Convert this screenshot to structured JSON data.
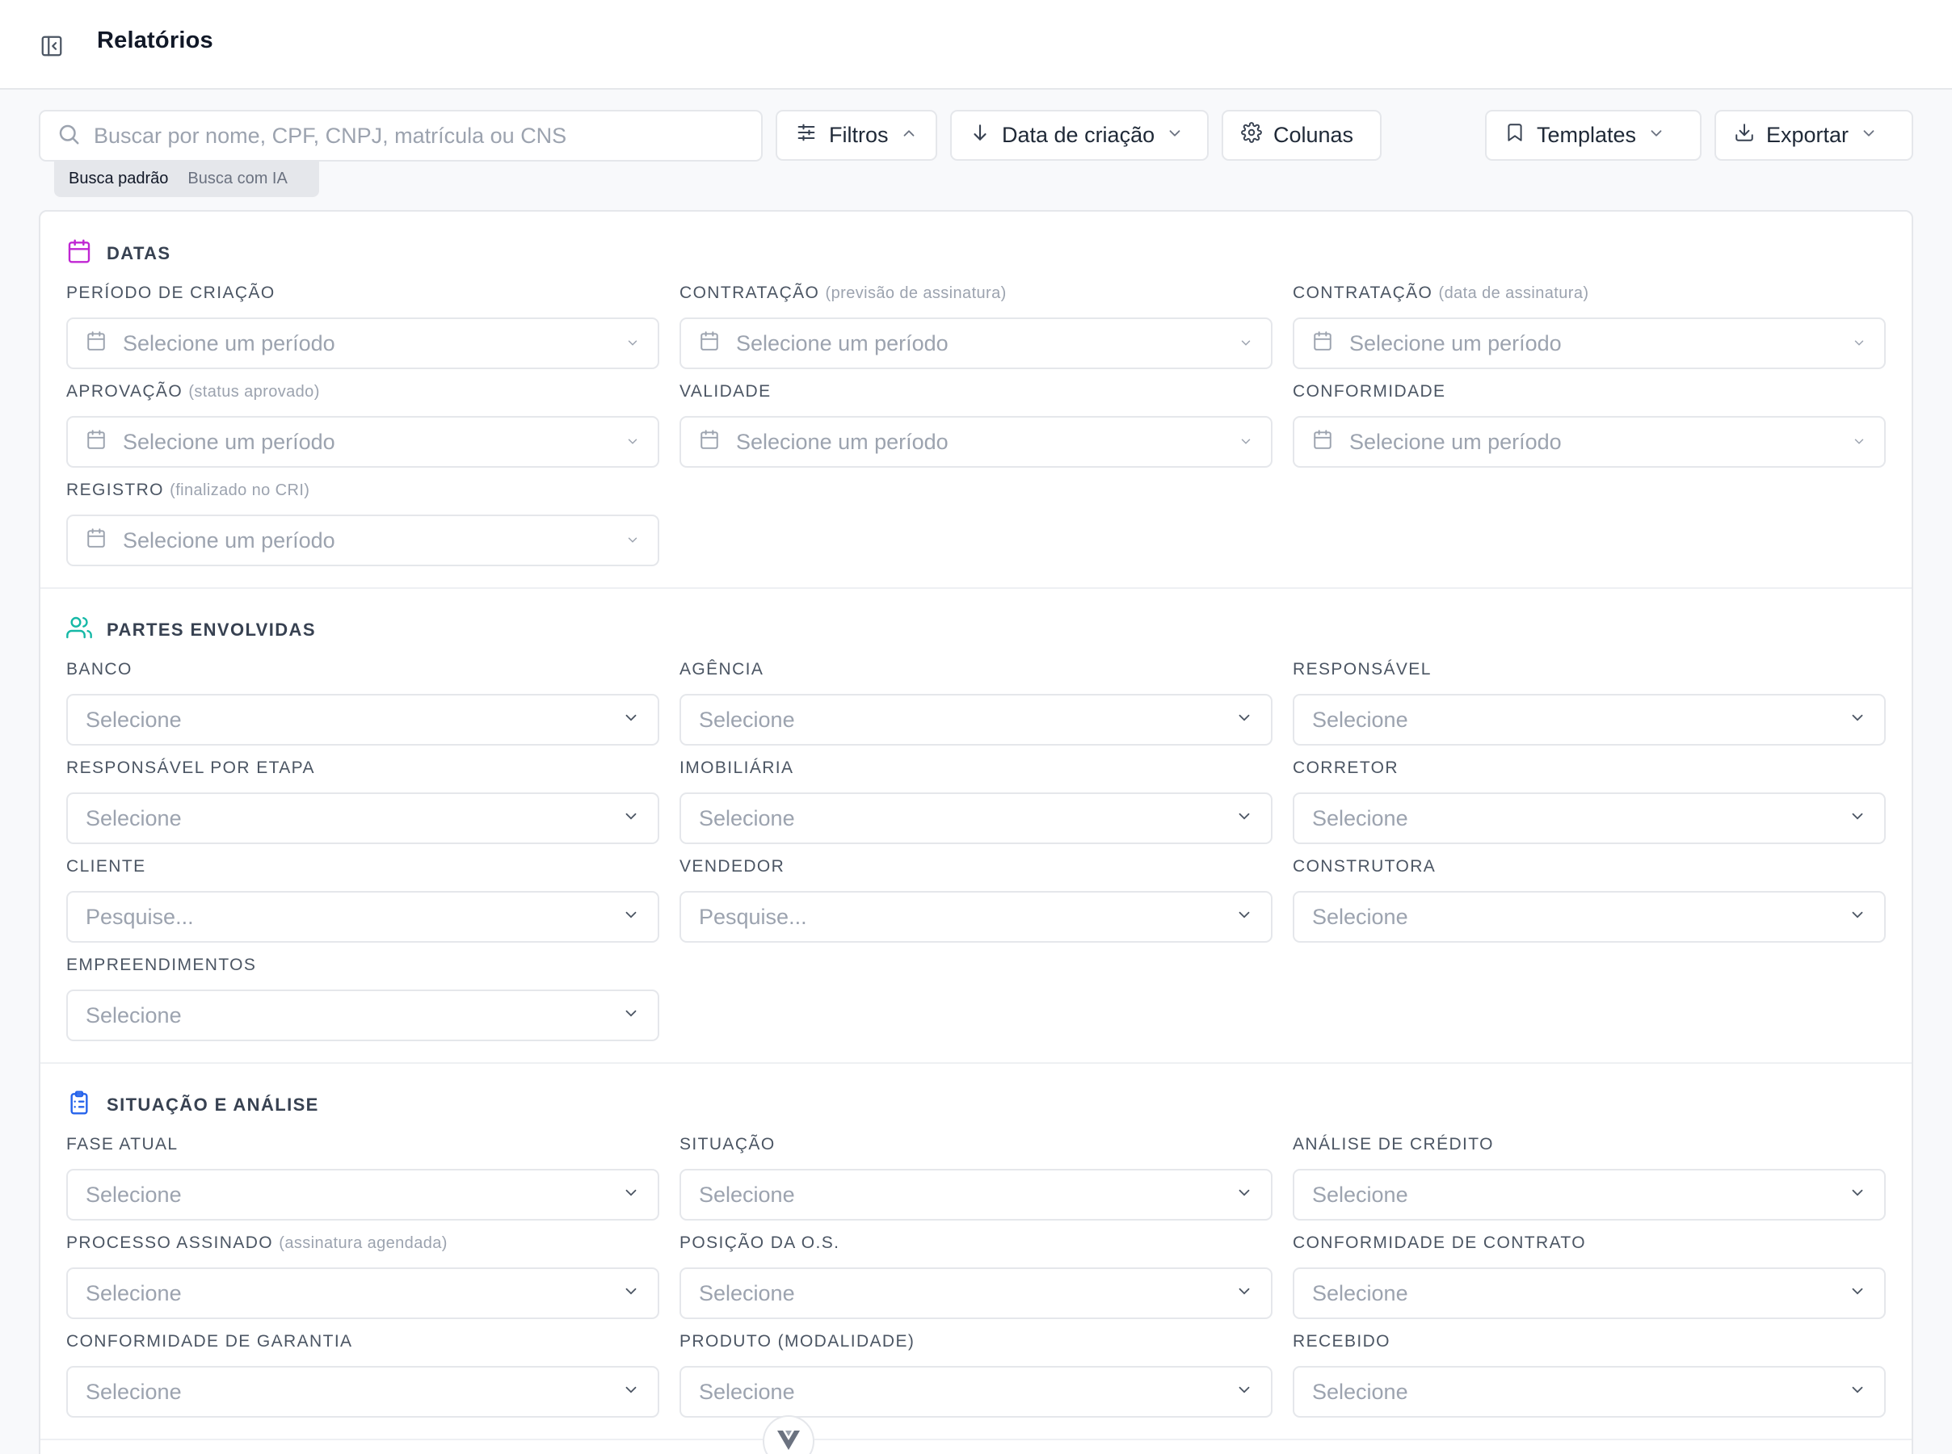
{
  "header": {
    "title": "Relatórios"
  },
  "search": {
    "placeholder": "Buscar por nome, CPF, CNPJ, matrícula ou CNS",
    "value": "",
    "modes": [
      "Busca padrão",
      "Busca com IA"
    ],
    "active_mode": "Busca padrão"
  },
  "toolbar": {
    "filters_label": "Filtros",
    "sort_label": "Data de criação",
    "columns_label": "Colunas",
    "templates_label": "Templates",
    "export_label": "Exportar"
  },
  "colors": {
    "dates_icon": "#c026d3",
    "parties_icon": "#14b8a6",
    "status_icon": "#2563eb",
    "border": "#e5e7eb",
    "placeholder": "#9ca3af"
  },
  "sections": {
    "dates": {
      "title": "DATAS",
      "icon": "calendar-icon",
      "fields": [
        {
          "label": "PERÍODO DE CRIAÇÃO",
          "hint": "",
          "placeholder": "Selecione um período"
        },
        {
          "label": "CONTRATAÇÃO",
          "hint": "(previsão de assinatura)",
          "placeholder": "Selecione um período"
        },
        {
          "label": "CONTRATAÇÃO",
          "hint": "(data de assinatura)",
          "placeholder": "Selecione um período"
        },
        {
          "label": "APROVAÇÃO",
          "hint": "(status aprovado)",
          "placeholder": "Selecione um período"
        },
        {
          "label": "VALIDADE",
          "hint": "",
          "placeholder": "Selecione um período"
        },
        {
          "label": "CONFORMIDADE",
          "hint": "",
          "placeholder": "Selecione um período"
        },
        {
          "label": "REGISTRO",
          "hint": "(finalizado no CRI)",
          "placeholder": "Selecione um período"
        }
      ]
    },
    "parties": {
      "title": "PARTES ENVOLVIDAS",
      "icon": "users-icon",
      "fields": [
        {
          "label": "BANCO",
          "placeholder": "Selecione"
        },
        {
          "label": "AGÊNCIA",
          "placeholder": "Selecione"
        },
        {
          "label": "RESPONSÁVEL",
          "placeholder": "Selecione"
        },
        {
          "label": "RESPONSÁVEL POR ETAPA",
          "placeholder": "Selecione"
        },
        {
          "label": "IMOBILIÁRIA",
          "placeholder": "Selecione"
        },
        {
          "label": "CORRETOR",
          "placeholder": "Selecione"
        },
        {
          "label": "CLIENTE",
          "placeholder": "Pesquise..."
        },
        {
          "label": "VENDEDOR",
          "placeholder": "Pesquise..."
        },
        {
          "label": "CONSTRUTORA",
          "placeholder": "Selecione"
        },
        {
          "label": "EMPREENDIMENTOS",
          "placeholder": "Selecione"
        }
      ]
    },
    "status": {
      "title": "SITUAÇÃO E ANÁLISE",
      "icon": "clipboard-list-icon",
      "fields": [
        {
          "label": "FASE ATUAL",
          "hint": "",
          "placeholder": "Selecione"
        },
        {
          "label": "SITUAÇÃO",
          "hint": "",
          "placeholder": "Selecione"
        },
        {
          "label": "ANÁLISE DE CRÉDITO",
          "hint": "",
          "placeholder": "Selecione"
        },
        {
          "label": "PROCESSO ASSINADO",
          "hint": "(assinatura agendada)",
          "placeholder": "Selecione"
        },
        {
          "label": "POSIÇÃO DA O.S.",
          "hint": "",
          "placeholder": "Selecione"
        },
        {
          "label": "CONFORMIDADE DE CONTRATO",
          "hint": "",
          "placeholder": "Selecione"
        },
        {
          "label": "CONFORMIDADE DE GARANTIA",
          "hint": "",
          "placeholder": "Selecione"
        },
        {
          "label": "PRODUTO (MODALIDADE)",
          "hint": "",
          "placeholder": "Selecione"
        },
        {
          "label": "RECEBIDO",
          "hint": "",
          "placeholder": "Selecione"
        }
      ]
    }
  }
}
